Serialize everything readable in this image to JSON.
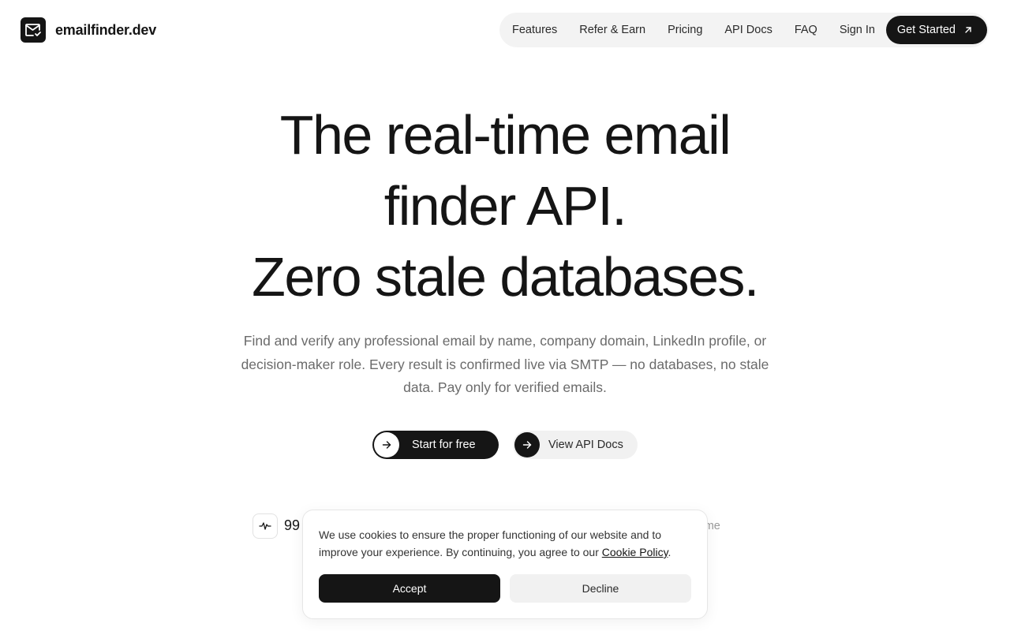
{
  "brand": {
    "name": "emailfinder.dev",
    "logo_icon": "mail-check-icon"
  },
  "nav": {
    "links": [
      "Features",
      "Refer & Earn",
      "Pricing",
      "API Docs",
      "FAQ",
      "Sign In"
    ],
    "cta": "Get Started",
    "cta_icon": "arrow-up-right-icon"
  },
  "hero": {
    "title_lines": [
      "The real-time email",
      "finder API.",
      "Zero stale databases."
    ],
    "subtitle": "Find and verify any professional email by name, company domain, LinkedIn profile, or decision-maker role. Every result is confirmed live via SMTP — no databases, no stale data. Pay only for verified emails.",
    "primary_cta": "Start for free",
    "secondary_cta": "View API Docs"
  },
  "stats": {
    "icon": "activity-icon",
    "value_visible": "99",
    "label_visible": "onse time"
  },
  "cookie": {
    "text_before_link": "We use cookies to ensure the proper functioning of our website and to improve your experience. By continuing, you agree to our ",
    "link": "Cookie Policy",
    "text_after_link": ".",
    "accept": "Accept",
    "decline": "Decline"
  },
  "colors": {
    "ink": "#151515",
    "muted": "#6b6b6b",
    "nav_bg": "#f3f3f3"
  }
}
